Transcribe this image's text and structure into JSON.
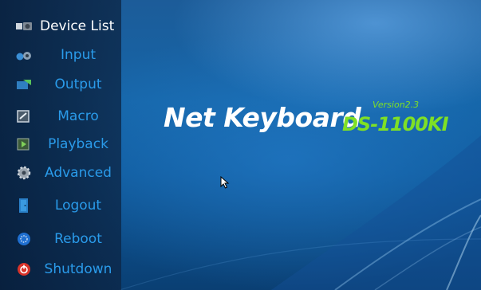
{
  "sidebar": {
    "items": [
      {
        "label": "Device List",
        "icon": "device-list-icon"
      },
      {
        "label": "Input",
        "icon": "input-icon"
      },
      {
        "label": "Output",
        "icon": "output-icon"
      },
      {
        "label": "Macro",
        "icon": "macro-icon"
      },
      {
        "label": "Playback",
        "icon": "playback-icon"
      },
      {
        "label": "Advanced",
        "icon": "gear-icon"
      },
      {
        "label": "Logout",
        "icon": "logout-door-icon"
      },
      {
        "label": "Reboot",
        "icon": "reboot-icon"
      },
      {
        "label": "Shutdown",
        "icon": "power-icon"
      }
    ],
    "selected": "Device List"
  },
  "brand": {
    "title": "Net Keyboard",
    "model": "DS-1100KI",
    "version": "Version2.3"
  },
  "colors": {
    "menu_label": "#2a9bea",
    "menu_label_active": "#ffffff",
    "brand_accent": "#7fe025",
    "sidebar_bg": "#0c2646",
    "background": "#1565a8"
  }
}
